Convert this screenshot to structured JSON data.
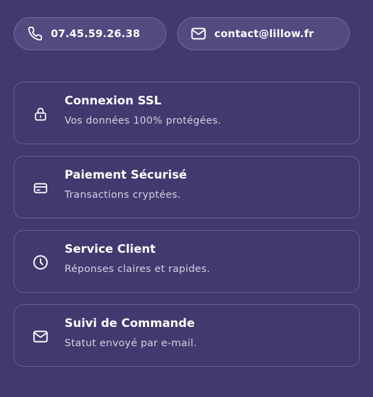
{
  "contact": {
    "phone": {
      "icon": "phone-icon",
      "label": "07.45.59.26.38"
    },
    "email": {
      "icon": "mail-icon",
      "label": "contact@lillow.fr"
    }
  },
  "features": [
    {
      "icon": "lock-icon",
      "title": "Connexion SSL",
      "description": "Vos données 100% protégées."
    },
    {
      "icon": "credit-card-icon",
      "title": "Paiement Sécurisé",
      "description": "Transactions cryptées."
    },
    {
      "icon": "clock-icon",
      "title": "Service Client",
      "description": "Réponses claires et rapides."
    },
    {
      "icon": "mail-icon",
      "title": "Suivi de Commande",
      "description": "Statut envoyé par e-mail."
    }
  ],
  "colors": {
    "background": "#43396f",
    "pill_background": "#544a7f",
    "text": "#ffffff",
    "muted_text": "#d5d1e6"
  }
}
